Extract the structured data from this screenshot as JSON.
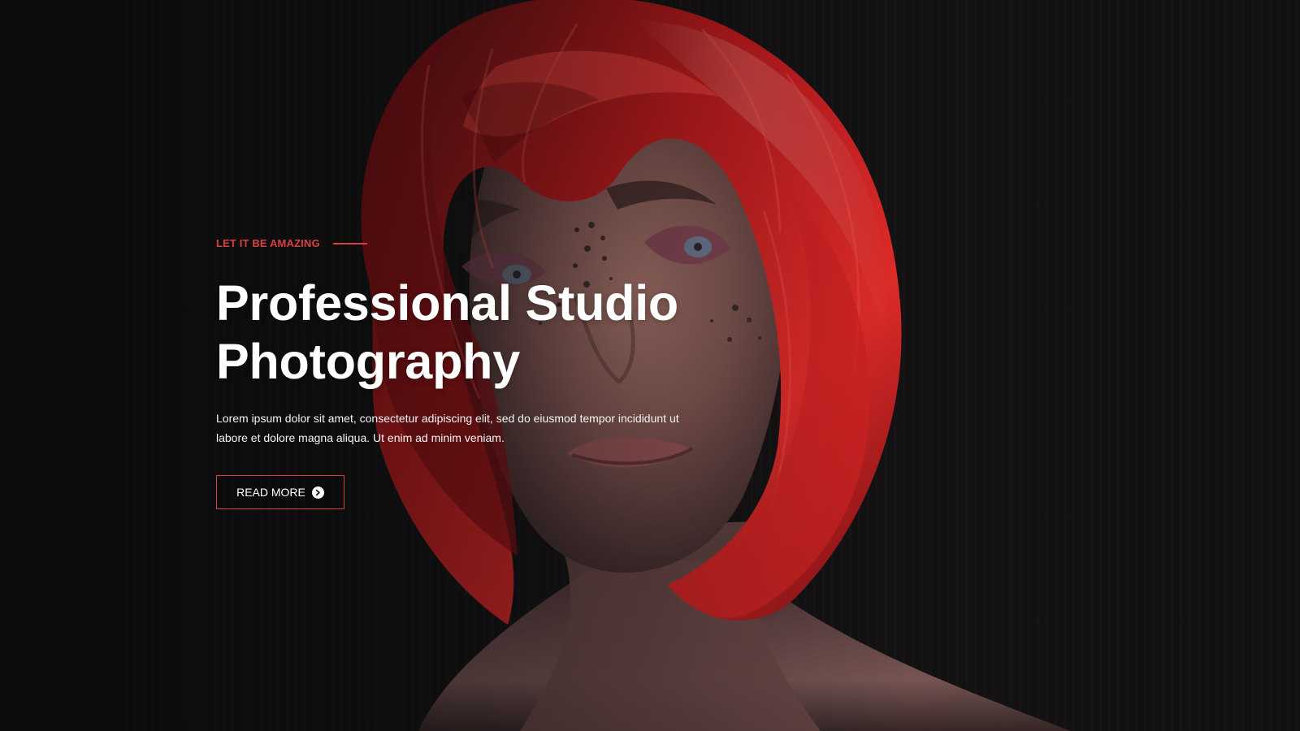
{
  "hero": {
    "eyebrow": "LET IT BE AMAZING",
    "title_line_1": "Professional Studio",
    "title_line_2": "Photography",
    "description": "Lorem ipsum dolor sit amet, consectetur adipiscing elit, sed do eiusmod tempor incididunt ut labore et dolore magna aliqua. Ut enim ad minim veniam.",
    "button_label": "READ MORE",
    "button_icon": "chevron-circle-right-icon",
    "accent_color": "#d8413f",
    "image_subject": "portrait"
  }
}
